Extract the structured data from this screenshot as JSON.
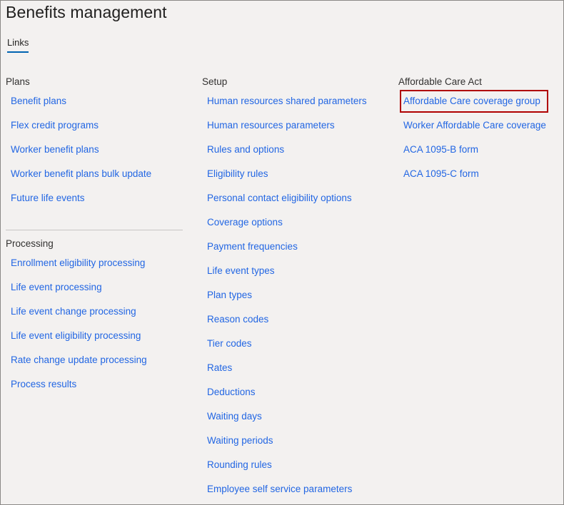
{
  "page": {
    "title": "Benefits management"
  },
  "tabs": [
    {
      "label": "Links"
    }
  ],
  "plans": {
    "header": "Plans",
    "links": [
      "Benefit plans",
      "Flex credit programs",
      "Worker benefit plans",
      "Worker benefit plans bulk update",
      "Future life events"
    ]
  },
  "processing": {
    "header": "Processing",
    "links": [
      "Enrollment eligibility processing",
      "Life event processing",
      "Life event change processing",
      "Life event eligibility processing",
      "Rate change update processing",
      "Process results"
    ]
  },
  "setup": {
    "header": "Setup",
    "links": [
      "Human resources shared parameters",
      "Human resources parameters",
      "Rules and options",
      "Eligibility rules",
      "Personal contact eligibility options",
      "Coverage options",
      "Payment frequencies",
      "Life event types",
      "Plan types",
      "Reason codes",
      "Tier codes",
      "Rates",
      "Deductions",
      "Waiting days",
      "Waiting periods",
      "Rounding rules",
      "Employee self service parameters"
    ]
  },
  "aca": {
    "header": "Affordable Care Act",
    "links": [
      "Affordable Care coverage group",
      "Worker Affordable Care coverage",
      "ACA 1095-B form",
      "ACA 1095-C form"
    ]
  },
  "colors": {
    "link": "#2266e3",
    "text": "#201f1e",
    "background": "#f3f1f0",
    "tab_underline": "#0063b1",
    "highlight_box": "#b00000"
  }
}
